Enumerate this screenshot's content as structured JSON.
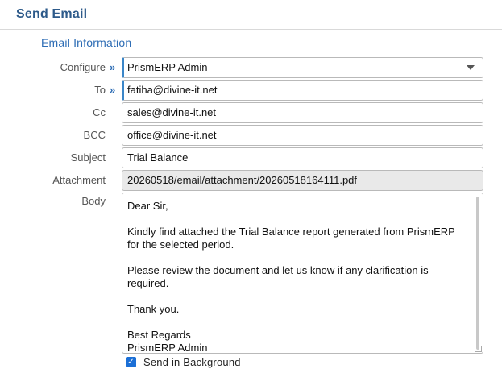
{
  "dialog": {
    "title": "Send Email"
  },
  "section": {
    "title": "Email Information"
  },
  "form": {
    "configure": {
      "label": "Configure",
      "value": "PrismERP Admin"
    },
    "to": {
      "label": "To",
      "value": "fatiha@divine-it.net"
    },
    "cc": {
      "label": "Cc",
      "value": "sales@divine-it.net"
    },
    "bcc": {
      "label": "BCC",
      "value": "office@divine-it.net"
    },
    "subject": {
      "label": "Subject",
      "value": "Trial Balance"
    },
    "attachment": {
      "label": "Attachment",
      "value": "20260518/email/attachment/20260518164111.pdf"
    },
    "body": {
      "label": "Body",
      "lines": [
        "Dear Sir,",
        "",
        "Kindly find attached the Trial Balance report generated from PrismERP",
        "for the selected period.",
        "",
        "Please review the document and let us know if any clarification is",
        "required.",
        "",
        "Thank you.",
        "",
        "Best Regards",
        "PrismERP Admin"
      ]
    },
    "send_background": {
      "label": "Send in Background",
      "checked": true
    }
  },
  "icons": {
    "required_marker": "»",
    "check": "✓"
  },
  "colors": {
    "title": "#2d5a8a",
    "section": "#2e6db5",
    "required_border": "#3a86c8",
    "checkbox": "#1b6fd6"
  }
}
